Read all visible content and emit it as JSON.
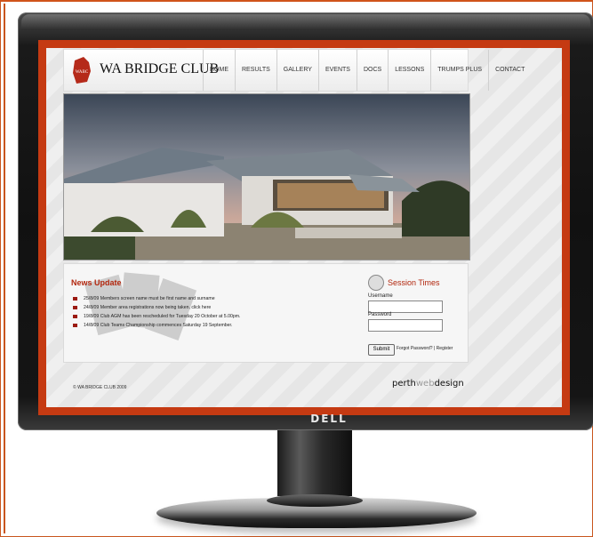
{
  "site": {
    "logo_badge": "WABC",
    "logo_text": "WA BRIDGE CLUB",
    "nav": [
      "HOME",
      "RESULTS",
      "GALLERY",
      "EVENTS",
      "DOCS",
      "LESSONS",
      "TRUMPS PLUS",
      "CONTACT"
    ]
  },
  "news": {
    "title": "News Update",
    "items": [
      "25/8/09 Members screen name must be first name and surname",
      "24/8/09 Member area registrations now being taken, click here",
      "19/8/09 Club AGM has been rescheduled for Tuesday 20 October at 5.00pm.",
      "14/8/09 Club Teams Championship commences Saturday 19 September."
    ]
  },
  "session": {
    "title": "Session Times",
    "username_label": "Username",
    "password_label": "Password",
    "submit_label": "Submit",
    "forgot_label": "Forgot Password?",
    "separator": "|",
    "register_label": "Register"
  },
  "footer": {
    "copyright": "© WA BRIDGE CLUB 2009",
    "credit_part1": "perth",
    "credit_part2": "web",
    "credit_part3": "design"
  },
  "monitor": {
    "brand": "DELL"
  },
  "colors": {
    "accent_red": "#b2270e",
    "screen_border": "#c53a12",
    "frame": "#c9561f"
  }
}
